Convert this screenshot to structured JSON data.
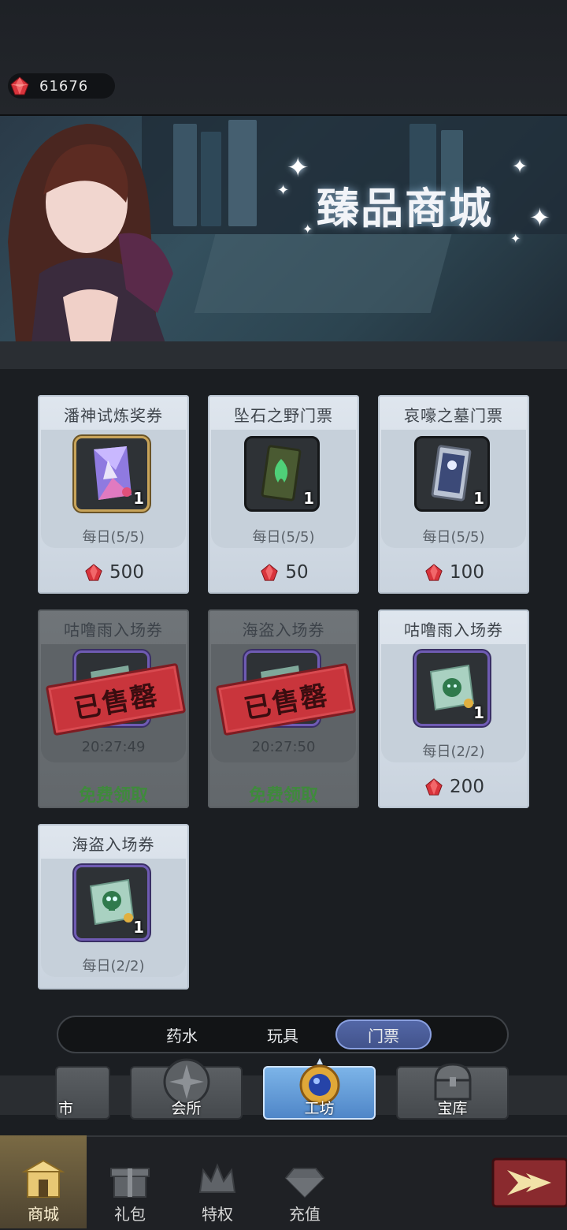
{
  "currency": {
    "value": "61676",
    "icon": "ruby-gem-icon"
  },
  "banner": {
    "title": "臻品商城"
  },
  "colors": {
    "tab_active": "#4a5c9a",
    "free_text": "#3f8a3c",
    "sold_stamp": "#c9353c"
  },
  "items": [
    {
      "name": "潘神试炼奖券",
      "qty": "1",
      "limit": "每日(5/5)",
      "price": "500",
      "icon": "crystal-ticket-icon"
    },
    {
      "name": "坠石之野门票",
      "qty": "1",
      "limit": "每日(5/5)",
      "price": "50",
      "icon": "green-card-icon"
    },
    {
      "name": "哀嚎之墓门票",
      "qty": "1",
      "limit": "每日(5/5)",
      "price": "100",
      "icon": "silver-card-icon"
    },
    {
      "name": "咕噜雨入场券",
      "stamp": "已售罄",
      "timer": "20:27:49",
      "free": "免费领取",
      "icon": "slime-ticket-icon"
    },
    {
      "name": "海盗入场券",
      "stamp": "已售罄",
      "timer": "20:27:50",
      "free": "免费领取",
      "icon": "skull-ticket-icon"
    },
    {
      "name": "咕噜雨入场券",
      "qty": "1",
      "limit": "每日(2/2)",
      "price": "200",
      "icon": "slime-ticket-icon"
    },
    {
      "name": "海盗入场券",
      "qty": "1",
      "limit": "每日(2/2)",
      "icon": "skull-ticket-icon"
    }
  ],
  "tabs": [
    "药水",
    "玩具",
    "门票"
  ],
  "active_tab": "门票",
  "subnav": [
    "市",
    "会所",
    "工坊",
    "宝库"
  ],
  "bottomnav": [
    "商城",
    "礼包",
    "特权",
    "充值"
  ]
}
